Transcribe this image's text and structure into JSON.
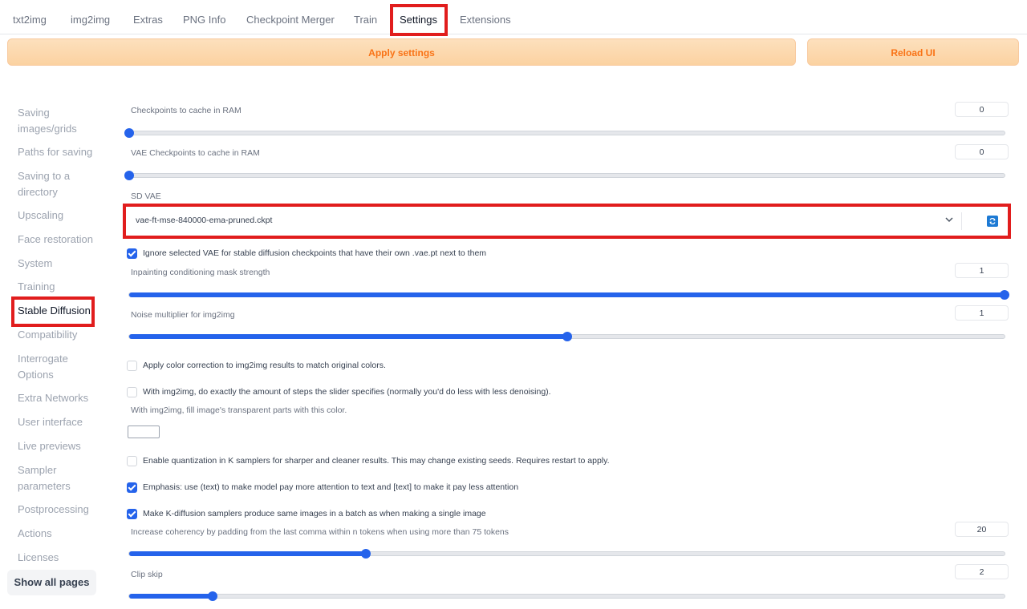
{
  "tabs": [
    "txt2img",
    "img2img",
    "Extras",
    "PNG Info",
    "Checkpoint Merger",
    "Train",
    "Settings",
    "Extensions"
  ],
  "active_tab": "Settings",
  "buttons": {
    "apply": "Apply settings",
    "reload": "Reload UI"
  },
  "sidebar": {
    "items": [
      "Saving images/grids",
      "Paths for saving",
      "Saving to a directory",
      "Upscaling",
      "Face restoration",
      "System",
      "Training",
      "Stable Diffusion",
      "Compatibility",
      "Interrogate Options",
      "Extra Networks",
      "User interface",
      "Live previews",
      "Sampler parameters",
      "Postprocessing",
      "Actions",
      "Licenses"
    ],
    "active": "Stable Diffusion",
    "show_all": "Show all pages"
  },
  "settings": {
    "ckpt_cache": {
      "label": "Checkpoints to cache in RAM",
      "value": "0",
      "fraction": 0.0
    },
    "vae_cache": {
      "label": "VAE Checkpoints to cache in RAM",
      "value": "0",
      "fraction": 0.0
    },
    "sd_vae": {
      "label": "SD VAE",
      "value": "vae-ft-mse-840000-ema-pruned.ckpt"
    },
    "ignore_vae": {
      "label": "Ignore selected VAE for stable diffusion checkpoints that have their own .vae.pt next to them",
      "checked": true
    },
    "inpaint_mask": {
      "label": "Inpainting conditioning mask strength",
      "value": "1",
      "fraction": 1.0
    },
    "noise_mult": {
      "label": "Noise multiplier for img2img",
      "value": "1",
      "fraction": 0.5
    },
    "color_correction": {
      "label": "Apply color correction to img2img results to match original colors.",
      "checked": false
    },
    "exact_steps": {
      "label": "With img2img, do exactly the amount of steps the slider specifies (normally you'd do less with less denoising).",
      "checked": false
    },
    "fill_color": {
      "label": "With img2img, fill image's transparent parts with this color.",
      "color": "#ffffff"
    },
    "quantization": {
      "label": "Enable quantization in K samplers for sharper and cleaner results. This may change existing seeds. Requires restart to apply.",
      "checked": false
    },
    "emphasis": {
      "label": "Emphasis: use (text) to make model pay more attention to text and [text] to make it pay less attention",
      "checked": true
    },
    "k_diffusion_batch": {
      "label": "Make K-diffusion samplers produce same images in a batch as when making a single image",
      "checked": true
    },
    "comma_padding": {
      "label": "Increase coherency by padding from the last comma within n tokens when using more than 75 tokens",
      "value": "20",
      "fraction": 0.27
    },
    "clip_skip": {
      "label": "Clip skip",
      "value": "2",
      "fraction": 0.095
    }
  },
  "colors": {
    "accent": "#2563eb",
    "highlight": "#e11d1d",
    "button_text": "#f97316"
  },
  "icons": {
    "dropdown": "chevron-down-icon",
    "refresh": "refresh-icon",
    "check": "checkmark-icon"
  }
}
